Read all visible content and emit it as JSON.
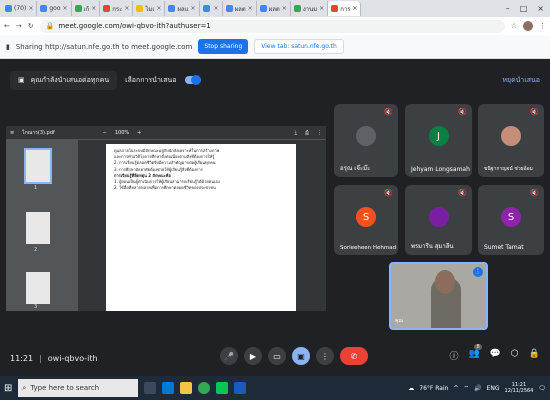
{
  "browser": {
    "tabs": [
      "(70)",
      "goo",
      "เก้",
      "กระ",
      "ไมเ",
      "ผลแ",
      "",
      "ผลต",
      "ผลต",
      "งานม",
      "การ"
    ],
    "url": "meet.google.com/owi-qbvo-ith?authuser=1"
  },
  "sharing": {
    "text": "Sharing http://satun.nfe.go.th to meet.google.com",
    "stop_label": "Stop sharing",
    "view_label": "View tab: satun.nfe.go.th"
  },
  "meet": {
    "presenter_label": "คุณกำลังนำเสนอต่อทุกคน",
    "present_toggle_label": "เลือกการนำเสนอ",
    "stop_presenting": "หยุดนำเสนอ",
    "meeting_time": "11:21",
    "meeting_code": "owi-qbvo-ith",
    "people_count": "8",
    "participants": [
      {
        "name": "อรุณ เจ๊ะม๊ะ",
        "initial": "",
        "color": "#5f6368"
      },
      {
        "name": "Jehyam Longsamah",
        "initial": "J",
        "color": "#0b8043"
      },
      {
        "name": "ขนิฐากาญจน์ ช่วยอ้อม",
        "initial": "",
        "color": "#c58e7a"
      },
      {
        "name": "Sorleeheen Hehmad",
        "initial": "S",
        "color": "#f4511e"
      },
      {
        "name": "พรมารีน สุมาลีน",
        "initial": "",
        "color": "#7b1fa2"
      },
      {
        "name": "Sumet Tamat",
        "initial": "S",
        "color": "#8e24aa"
      }
    ],
    "self_name": "คุณ"
  },
  "pdf": {
    "filename": "ไกณาร(3).pdf",
    "zoom": "100%",
    "pages": [
      "1",
      "2",
      "3"
    ],
    "lines": [
      "ดูแลภายในระบบมีลักษณะอยู่กับนักสังเคราะห์ในการสร้างภาพ",
      "และการทำอวิดีโอการศึกษาตั้งต่อเนื่องตามสิ่งที่ต้องการให้รู้",
      "2. การเรียนรู้ตลอดชีวิตจึงมีความสำคัญมากต่อผู้เรียนทุกคน",
      "3. การศึกษาอัธยาศัยต้องช่วยให้ผู้เรียนรู้สิ่งที่ต้องการ",
      "การเรียนรู้ที่ยืดหยุ่น 2 ลักษณะคือ",
      "1. ผู้สอนเป็นผู้ดำเนินการให้ผู้เรียนสามารถเรียนรู้ได้ด้วยตนเอง",
      "2. ใช้สื่อที่หลากหลายเพื่อการศึกษาตลอดชีวิตของประชาชน"
    ]
  },
  "taskbar": {
    "search_placeholder": "Type here to search",
    "weather": "76°F Rain",
    "lang": "ENG",
    "time": "11:21",
    "date": "12/11/2564"
  }
}
